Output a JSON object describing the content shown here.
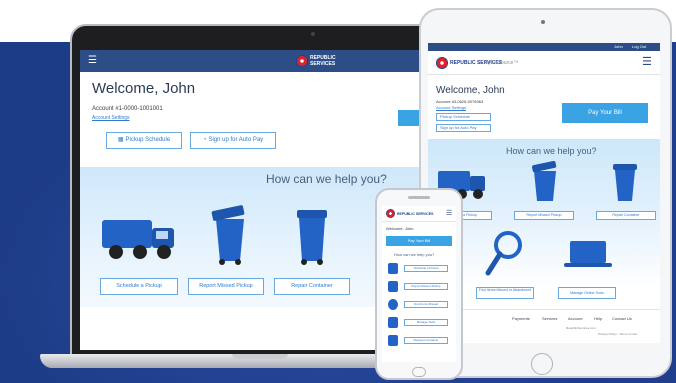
{
  "laptop": {
    "menu_icon": "hamburger-icon",
    "logo_text": "REPUBLIC SERVICES",
    "welcome": "Welcome, John",
    "account": "Account #1-0000-1001001",
    "account_link": "Account Settings",
    "buttons": [
      {
        "label": "Pickup Schedule",
        "icon": "calendar-icon"
      },
      {
        "label": "Sign up for Auto Pay",
        "icon": "piggy-bank-icon"
      }
    ],
    "help_title": "How can we help you?",
    "services": [
      {
        "label": "Schedule a Pickup",
        "icon": "truck-icon"
      },
      {
        "label": "Report Missed Pickup",
        "icon": "bin-open-icon"
      },
      {
        "label": "Repair Container",
        "icon": "bin-repair-icon"
      }
    ]
  },
  "tablet": {
    "top_links": [
      "John",
      "Log Out"
    ],
    "logo_text": "REPUBLIC SERVICES",
    "my_resource": "My Resource™",
    "welcome": "Welcome, John",
    "account": "Account #3-0625-0076963",
    "account_link": "Account Settings",
    "small_buttons": [
      "Pickup Schedule",
      "Sign up for Auto Pay"
    ],
    "pay_button": "Pay Your Bill",
    "help_title": "How can we help you?",
    "services_row1": [
      "Schedule a Pickup",
      "Report Missed Pickup",
      "Repair Container"
    ],
    "services_row2": [
      "Find Items Missed or Abandoned",
      "Manage Online Tools"
    ],
    "footer_links": [
      "Payments",
      "Services",
      "Account",
      "Help",
      "Contact Us"
    ],
    "footer_sub": [
      "RepublicServices.com",
      "Privacy Policy  •  Terms of Use"
    ]
  },
  "phone": {
    "logo_text": "REPUBLIC SERVICES",
    "welcome": "Welcome, John",
    "pay_button": "Pay Your Bill",
    "help_title": "How can we help you?",
    "items": [
      "Schedule a Pickup",
      "Report Missed Pickup",
      "Find Items Missed",
      "Manage Tools",
      "Request Container"
    ]
  },
  "colors": {
    "navy_band": "#1d3c86",
    "header_blue": "#2d4d86",
    "accent_blue": "#3aa3e3",
    "link_blue": "#2f7bd1",
    "logo_red": "#d9252a"
  }
}
